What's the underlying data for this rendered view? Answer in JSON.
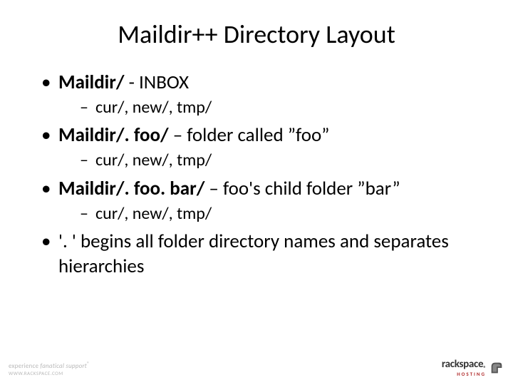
{
  "title": "Maildir++ Directory Layout",
  "bullets": [
    {
      "bold": "Maildir/",
      "rest": " - INBOX",
      "sub": "cur/, new/, tmp/"
    },
    {
      "bold": "Maildir/. foo/",
      "rest": " – folder called ”foo”",
      "sub": "cur/, new/, tmp/"
    },
    {
      "bold": "Maildir/. foo. bar/",
      "rest": " – foo's child folder ”bar”",
      "sub": "cur/, new/, tmp/"
    },
    {
      "bold": "",
      "rest": "'. ' begins all folder directory names and separates hierarchies",
      "sub": null
    }
  ],
  "footer": {
    "left_line1_a": "experience ",
    "left_line1_b": "fanatical support",
    "left_line2": "WWW.RACKSPACE.COM",
    "right_brand": "rackspace",
    "right_sub": "HOSTING"
  }
}
